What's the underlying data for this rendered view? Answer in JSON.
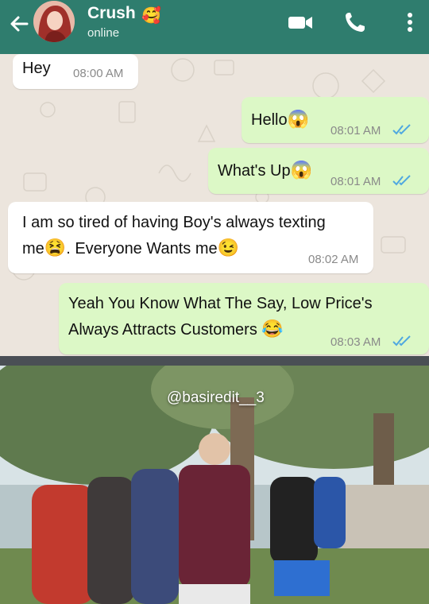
{
  "header": {
    "name": "Crush",
    "name_emoji": "🥰",
    "status": "online",
    "icons": [
      "back-arrow-icon",
      "video-call-icon",
      "phone-call-icon",
      "more-options-icon"
    ],
    "bg_color": "#2f7d6e"
  },
  "chat": {
    "bg_color": "#ece5dd",
    "incoming_color": "#ffffff",
    "outgoing_color": "#dcf8c6",
    "tick_color": "#4fa8e0",
    "messages": [
      {
        "direction": "incoming",
        "text": "Hey",
        "time": "08:00 AM"
      },
      {
        "direction": "outgoing",
        "text": "Hello",
        "emoji": "😱",
        "time": "08:01 AM",
        "read": true
      },
      {
        "direction": "outgoing",
        "text": "What's Up",
        "emoji": "😱",
        "time": "08:01 AM",
        "read": true
      },
      {
        "direction": "incoming",
        "line1": "I am so tired of having Boy's always texting",
        "line2_a": "me",
        "emoji_a": "😫",
        "line2_b": ". Everyone Wants me",
        "emoji_b": "😉",
        "time": "08:02 AM"
      },
      {
        "direction": "outgoing",
        "line1": "Yeah You Know What The Say, Low Price's",
        "line2": "Always Attracts Customers",
        "emoji": "😂",
        "time": "08:03 AM",
        "read": true
      }
    ]
  },
  "video": {
    "watermark": "@basiredit__3",
    "description": "video frame"
  }
}
